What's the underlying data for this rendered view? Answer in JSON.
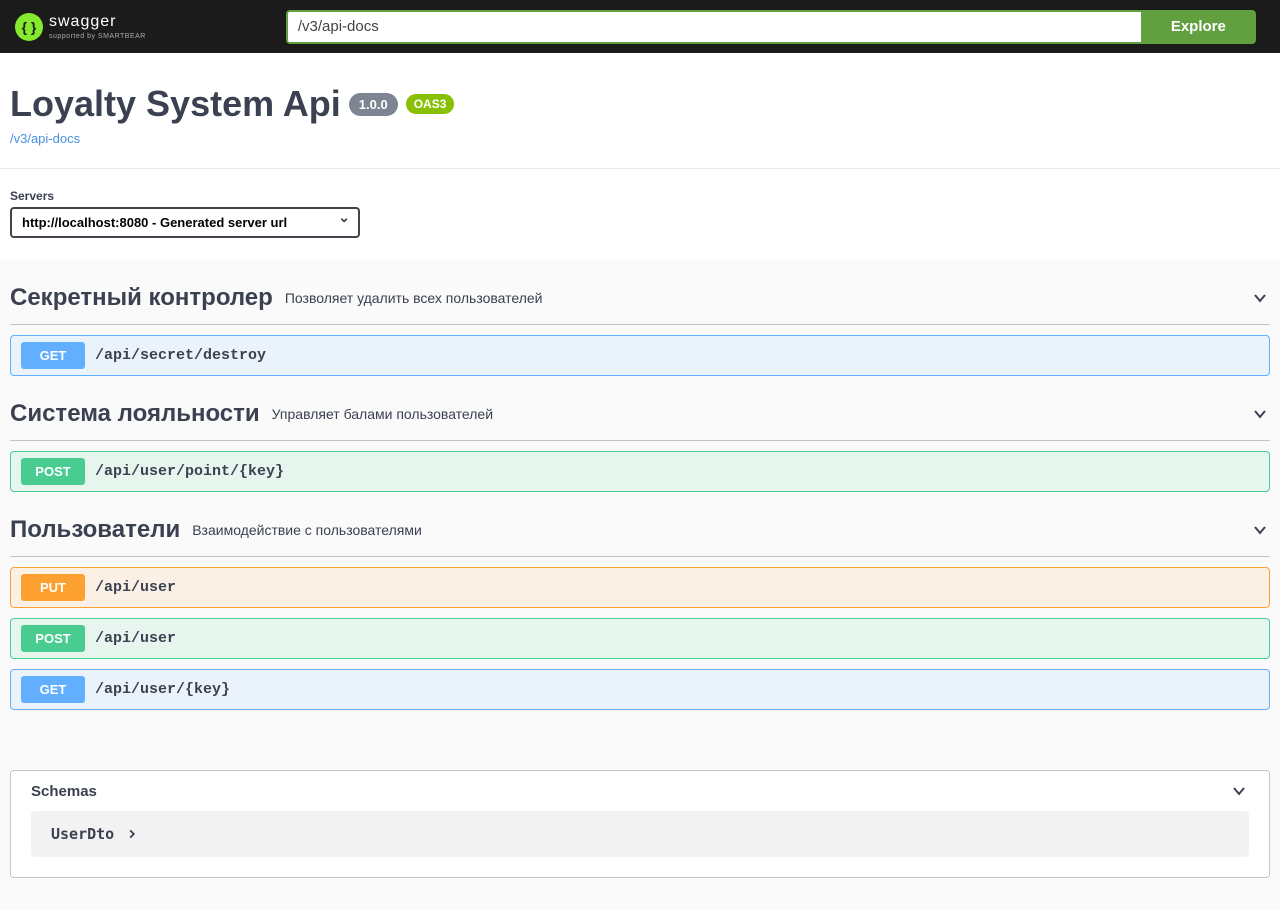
{
  "topbar": {
    "brand_main": "swagger",
    "brand_sub": "supported by SMARTBEAR",
    "input_value": "/v3/api-docs",
    "explore_label": "Explore"
  },
  "info": {
    "title": "Loyalty System Api",
    "version": "1.0.0",
    "oas_label": "OAS3",
    "docs_link": "/v3/api-docs"
  },
  "servers": {
    "label": "Servers",
    "selected": "http://localhost:8080 - Generated server url"
  },
  "tags": [
    {
      "name": "Секретный контролер",
      "description": "Позволяет удалить всех пользователей",
      "operations": [
        {
          "method": "GET",
          "method_class": "get",
          "path": "/api/secret/destroy"
        }
      ]
    },
    {
      "name": "Система лояльности",
      "description": "Управляет балами пользователей",
      "operations": [
        {
          "method": "POST",
          "method_class": "post",
          "path": "/api/user/point/{key}"
        }
      ]
    },
    {
      "name": "Пользователи",
      "description": "Взаимодействие с пользователями",
      "operations": [
        {
          "method": "PUT",
          "method_class": "put",
          "path": "/api/user"
        },
        {
          "method": "POST",
          "method_class": "post",
          "path": "/api/user"
        },
        {
          "method": "GET",
          "method_class": "get",
          "path": "/api/user/{key}"
        }
      ]
    }
  ],
  "schemas": {
    "title": "Schemas",
    "models": [
      {
        "name": "UserDto"
      }
    ]
  }
}
